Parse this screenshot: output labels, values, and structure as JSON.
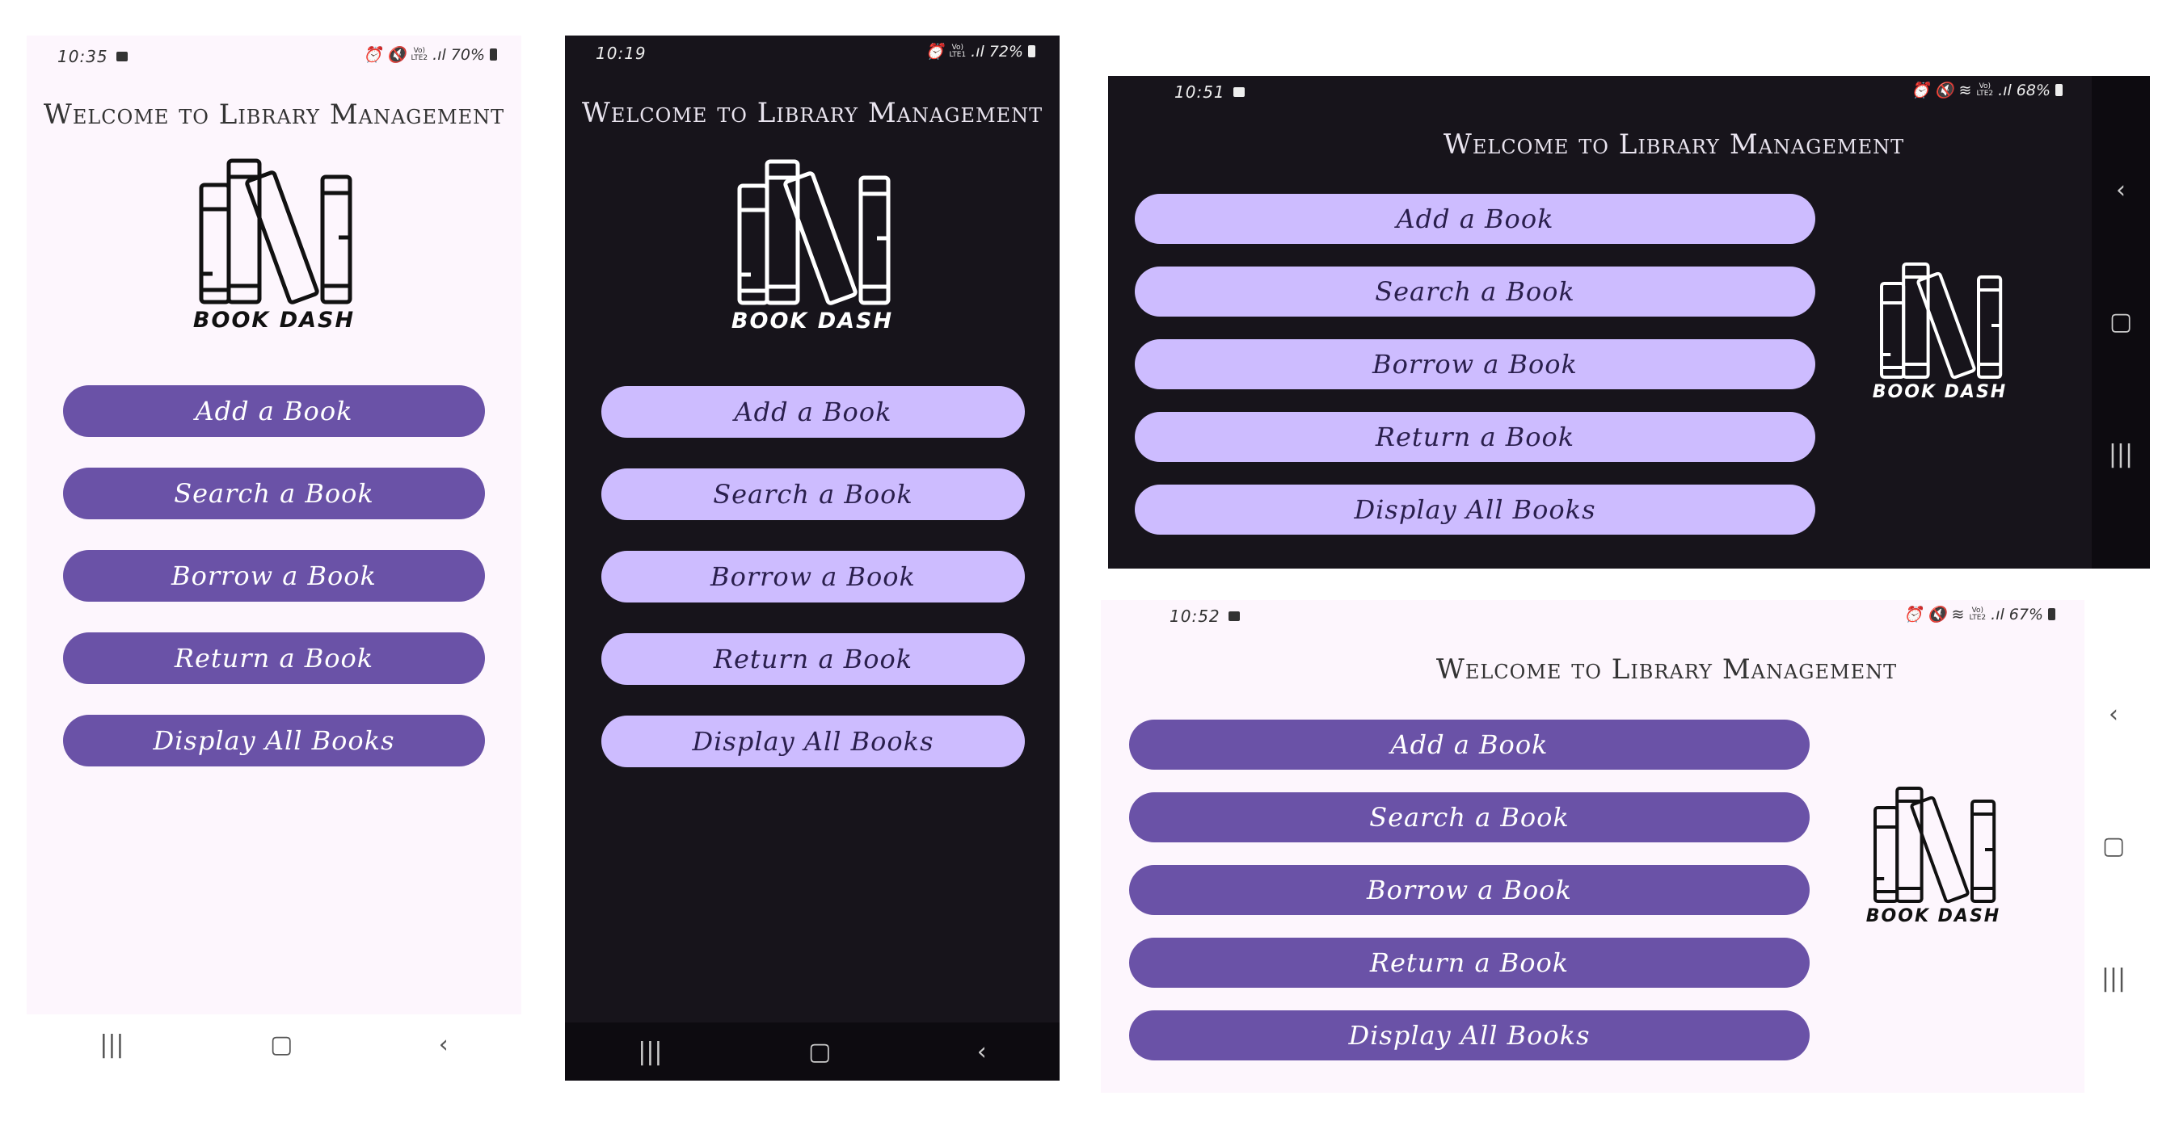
{
  "app": {
    "title": "Welcome to Library Management",
    "logo_text": "BOOK DASH",
    "buttons": [
      "Add a Book",
      "Search a Book",
      "Borrow a Book",
      "Return a Book",
      "Display All Books"
    ]
  },
  "colors": {
    "light_bg": "#fdf6fd",
    "light_button": "#6a52a7",
    "dark_bg": "#17141b",
    "dark_button": "#cdbcff"
  },
  "screens": [
    {
      "theme": "light",
      "orientation": "portrait",
      "time": "10:35",
      "battery": "70%"
    },
    {
      "theme": "dark",
      "orientation": "portrait",
      "time": "10:19",
      "battery": "72%"
    },
    {
      "theme": "dark",
      "orientation": "landscape",
      "time": "10:51",
      "battery": "68%"
    },
    {
      "theme": "light",
      "orientation": "landscape",
      "time": "10:52",
      "battery": "67%"
    }
  ],
  "status_icons": [
    "image-icon",
    "alarm-icon",
    "mute-icon",
    "volte-icon",
    "signal-icon",
    "battery-icon"
  ],
  "nav_icons": {
    "recents": "|||",
    "home": "▢",
    "back": "‹"
  },
  "network": {
    "volte": "Vo)",
    "lte1": "LTE1",
    "lte2": "LTE2"
  }
}
